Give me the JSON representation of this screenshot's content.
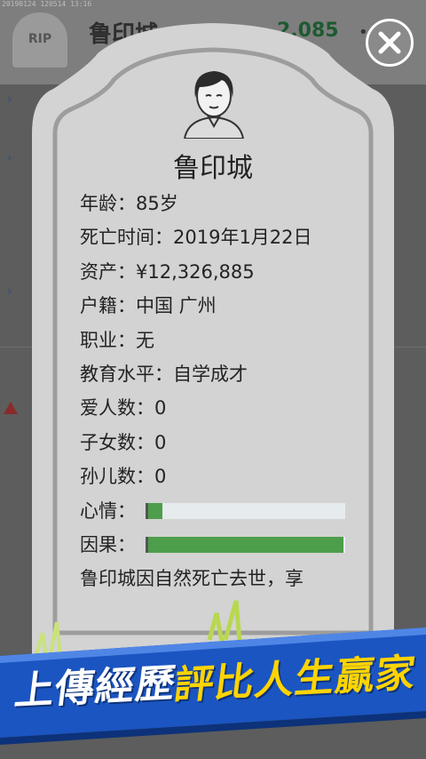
{
  "background": {
    "timestamp": "20190124 120514 13:16",
    "rip_label": "RIP",
    "player_name": "鲁印城",
    "money": "2.085",
    "menu_glyph": "•"
  },
  "tombstone": {
    "name": "鲁印城",
    "fields": [
      {
        "label": "年龄",
        "value": "85岁"
      },
      {
        "label": "死亡时间",
        "value": "2019年1月22日"
      },
      {
        "label": "资产",
        "value": "¥12,326,885"
      },
      {
        "label": "户籍",
        "value": "中国 广州"
      },
      {
        "label": "职业",
        "value": "无"
      },
      {
        "label": "教育水平",
        "value": "自学成才"
      },
      {
        "label": "爱人数",
        "value": "0"
      },
      {
        "label": "子女数",
        "value": "0"
      },
      {
        "label": "孙儿数",
        "value": "0"
      }
    ],
    "mood": {
      "label": "心情：",
      "fraction": 0.07
    },
    "karma": {
      "label": "因果：",
      "fraction": 0.99
    },
    "description": "鲁印城因自然死亡去世，享"
  },
  "close_icon": "close-icon",
  "banner": {
    "left_text": "上傳經歷",
    "right_text": "評比人生贏家"
  },
  "colors": {
    "tombstone": "#d2d2d2",
    "bar_fill": "#4d9e4a",
    "banner_blue": "#1b55c2",
    "banner_yellow": "#ffd400"
  }
}
